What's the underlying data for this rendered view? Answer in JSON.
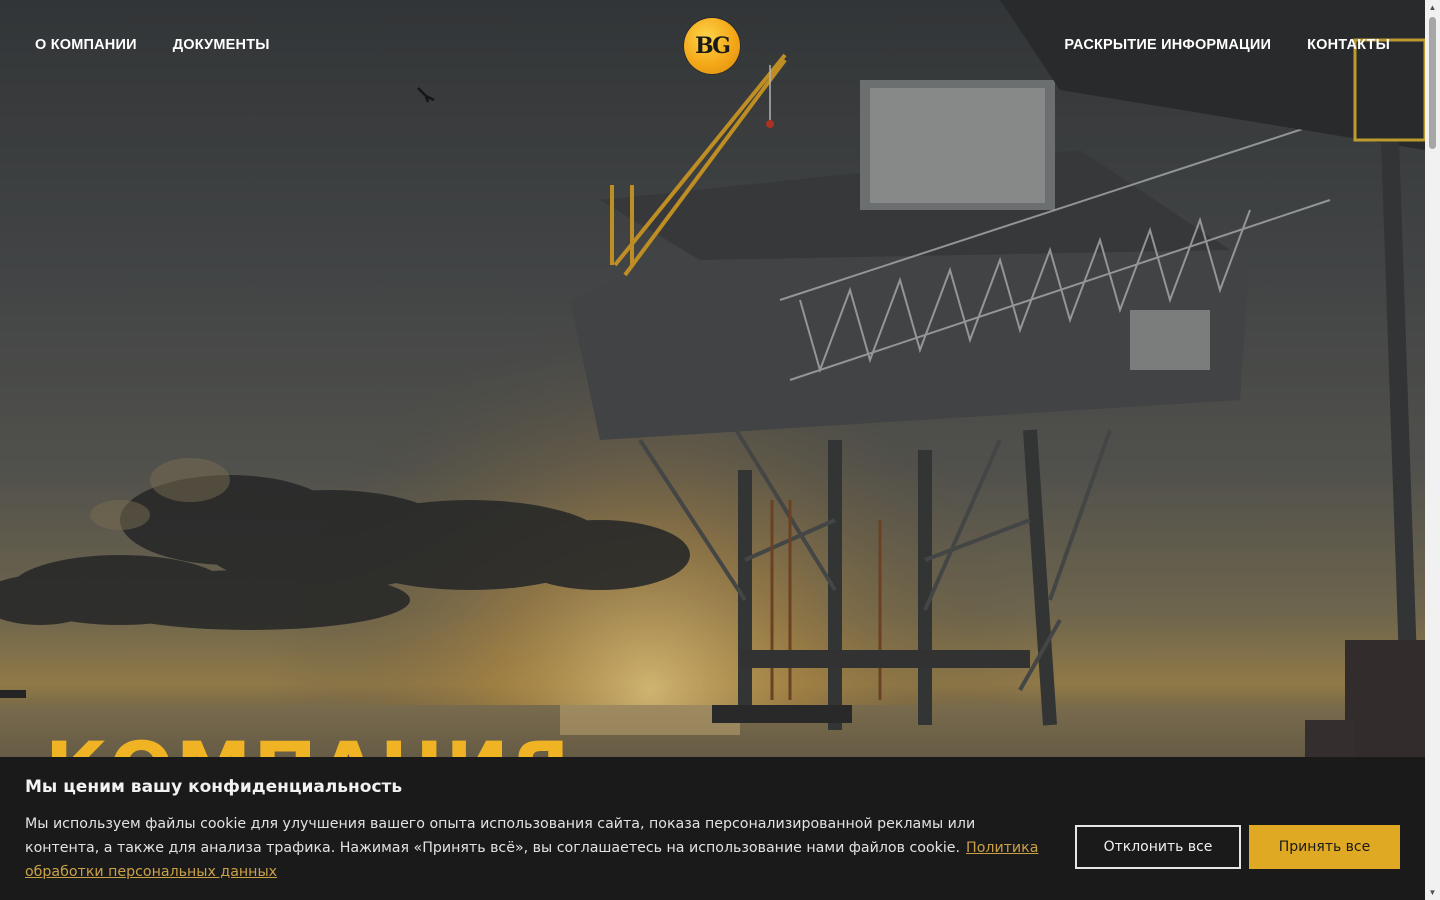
{
  "nav": {
    "left": [
      {
        "label": "О КОМПАНИИ"
      },
      {
        "label": "ДОКУМЕНТЫ"
      }
    ],
    "right": [
      {
        "label": "РАСКРЫТИЕ ИНФОРМАЦИИ"
      },
      {
        "label": "КОНТАКТЫ"
      }
    ]
  },
  "logo": {
    "text": "BG"
  },
  "hero": {
    "title": "КОМПАНИЯ"
  },
  "cookie": {
    "title": "Мы ценим вашу конфиденциальность",
    "text": "Мы используем файлы cookie для улучшения вашего опыта использования сайта, показа персонализированной рекламы или контента, а также для анализа трафика. Нажимая «Принять всё», вы соглашаетесь на использование нами файлов cookie.",
    "policy_link": "Политика обработки персональных данных",
    "decline_label": "Отклонить все",
    "accept_label": "Принять все"
  },
  "colors": {
    "accent": "#e0a923",
    "banner_bg": "#1a1a1a"
  }
}
